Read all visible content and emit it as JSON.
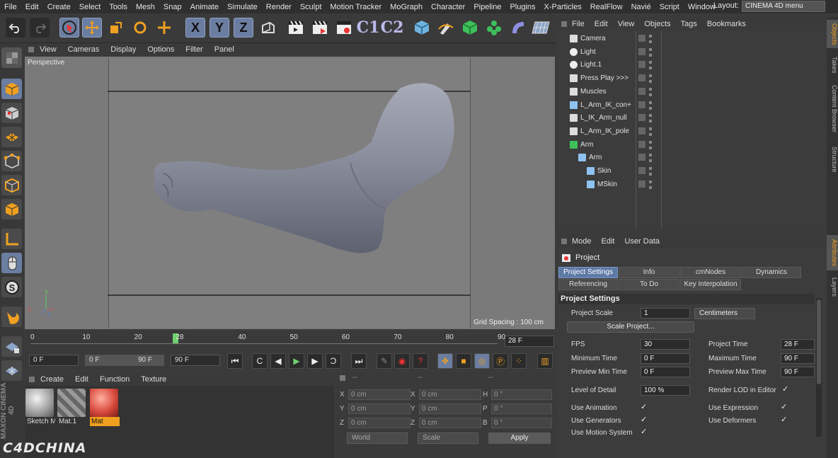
{
  "menubar": {
    "items": [
      "File",
      "Edit",
      "Create",
      "Select",
      "Tools",
      "Mesh",
      "Snap",
      "Animate",
      "Simulate",
      "Render",
      "Sculpt",
      "Motion Tracker",
      "MoGraph",
      "Character",
      "Pipeline",
      "Plugins",
      "X-Particles",
      "RealFlow",
      "Navié",
      "Script",
      "Window"
    ],
    "layout_label": "Layout:",
    "layout_value": "CINEMA 4D menu"
  },
  "toolbar": {
    "axis_x": "X",
    "axis_y": "Y",
    "axis_z": "Z",
    "c1": "C1",
    "c2": "C2"
  },
  "viewport": {
    "menu": [
      "View",
      "Cameras",
      "Display",
      "Options",
      "Filter",
      "Panel"
    ],
    "label": "Perspective",
    "grid_spacing": "Grid Spacing : 100 cm"
  },
  "timeline": {
    "ticks": [
      "0",
      "10",
      "20",
      "28",
      "40",
      "50",
      "60",
      "70",
      "80",
      "90"
    ],
    "current_frame": "28 F",
    "current_value": 28,
    "max_value": 90
  },
  "transport": {
    "start": "0 F",
    "range_start": "0 F",
    "range_end": "90 F",
    "end": "90 F"
  },
  "materials": {
    "menu": [
      "Create",
      "Edit",
      "Function",
      "Texture"
    ],
    "items": [
      {
        "name": "Sketch M",
        "color": "#bdbdbd"
      },
      {
        "name": "Mat.1",
        "color": "#8a8a8a"
      },
      {
        "name": "Mat",
        "color": "#d94a3e"
      }
    ]
  },
  "coordinates": {
    "header": [
      "--",
      "--",
      "--"
    ],
    "rows": [
      {
        "a": "X",
        "av": "0 cm",
        "b": "X",
        "bv": "0 cm",
        "c": "H",
        "cv": "0 °"
      },
      {
        "a": "Y",
        "av": "0 cm",
        "b": "Y",
        "bv": "0 cm",
        "c": "P",
        "cv": "0 °"
      },
      {
        "a": "Z",
        "av": "0 cm",
        "b": "Z",
        "bv": "0 cm",
        "c": "B",
        "cv": "0 °"
      }
    ],
    "world": "World",
    "scale": "Scale",
    "apply": "Apply"
  },
  "objects": {
    "menu": [
      "File",
      "Edit",
      "View",
      "Objects",
      "Tags",
      "Bookmarks"
    ],
    "items": [
      {
        "name": "Camera",
        "indent": 0,
        "icon": "camera-icon"
      },
      {
        "name": "Light",
        "indent": 0,
        "icon": "light-icon"
      },
      {
        "name": "Light.1",
        "indent": 0,
        "icon": "light-icon"
      },
      {
        "name": "Press Play >>>",
        "indent": 0,
        "icon": "null-icon"
      },
      {
        "name": "Muscles",
        "indent": 0,
        "icon": "null-icon"
      },
      {
        "name": "L_Arm_IK_con+",
        "indent": 0,
        "icon": "spline-icon"
      },
      {
        "name": "L_IK_Arm_null",
        "indent": 0,
        "icon": "null-icon"
      },
      {
        "name": "L_Arm_IK_pole",
        "indent": 0,
        "icon": "null-icon"
      },
      {
        "name": "Arm",
        "indent": 0,
        "icon": "polygon-icon"
      },
      {
        "name": "Arm",
        "indent": 1,
        "icon": "joint-icon"
      },
      {
        "name": "Skin",
        "indent": 2,
        "icon": "skin-icon"
      },
      {
        "name": "MSkin",
        "indent": 2,
        "icon": "mskin-icon"
      }
    ]
  },
  "attributes": {
    "menu": [
      "Mode",
      "Edit",
      "User Data"
    ],
    "title": "Project",
    "tabs_row1": [
      "Project Settings",
      "Info",
      "cmNodes",
      "Dynamics"
    ],
    "tabs_row2": [
      "Referencing",
      "To Do",
      "Key Interpolation"
    ],
    "section": "Project Settings",
    "project_scale_label": "Project Scale",
    "project_scale_value": "1",
    "project_scale_unit": "Centimeters",
    "scale_project_button": "Scale Project...",
    "fps_label": "FPS",
    "fps_value": "30",
    "project_time_label": "Project Time",
    "project_time_value": "28 F",
    "min_time_label": "Minimum Time",
    "min_time_value": "0 F",
    "max_time_label": "Maximum Time",
    "max_time_value": "90 F",
    "preview_min_label": "Preview Min Time",
    "preview_min_value": "0 F",
    "preview_max_label": "Preview Max Time",
    "preview_max_value": "90 F",
    "lod_label": "Level of Detail",
    "lod_value": "100 %",
    "render_lod_label": "Render LOD in Editor",
    "use_animation_label": "Use Animation",
    "use_expression_label": "Use Expression",
    "use_generators_label": "Use Generators",
    "use_deformers_label": "Use Deformers",
    "use_motion_label": "Use Motion System"
  },
  "right_tabs": [
    "Objects",
    "Takes",
    "Content Browser",
    "Structure",
    "Attributes",
    "Layers"
  ],
  "branding": {
    "maxon": "MAXON CINEMA 4D",
    "watermark": "C4DCHINA"
  },
  "colors": {
    "accent": "#6b7da0",
    "timeline_handle": "#6fd06f",
    "material_red": "#d94a3e"
  }
}
